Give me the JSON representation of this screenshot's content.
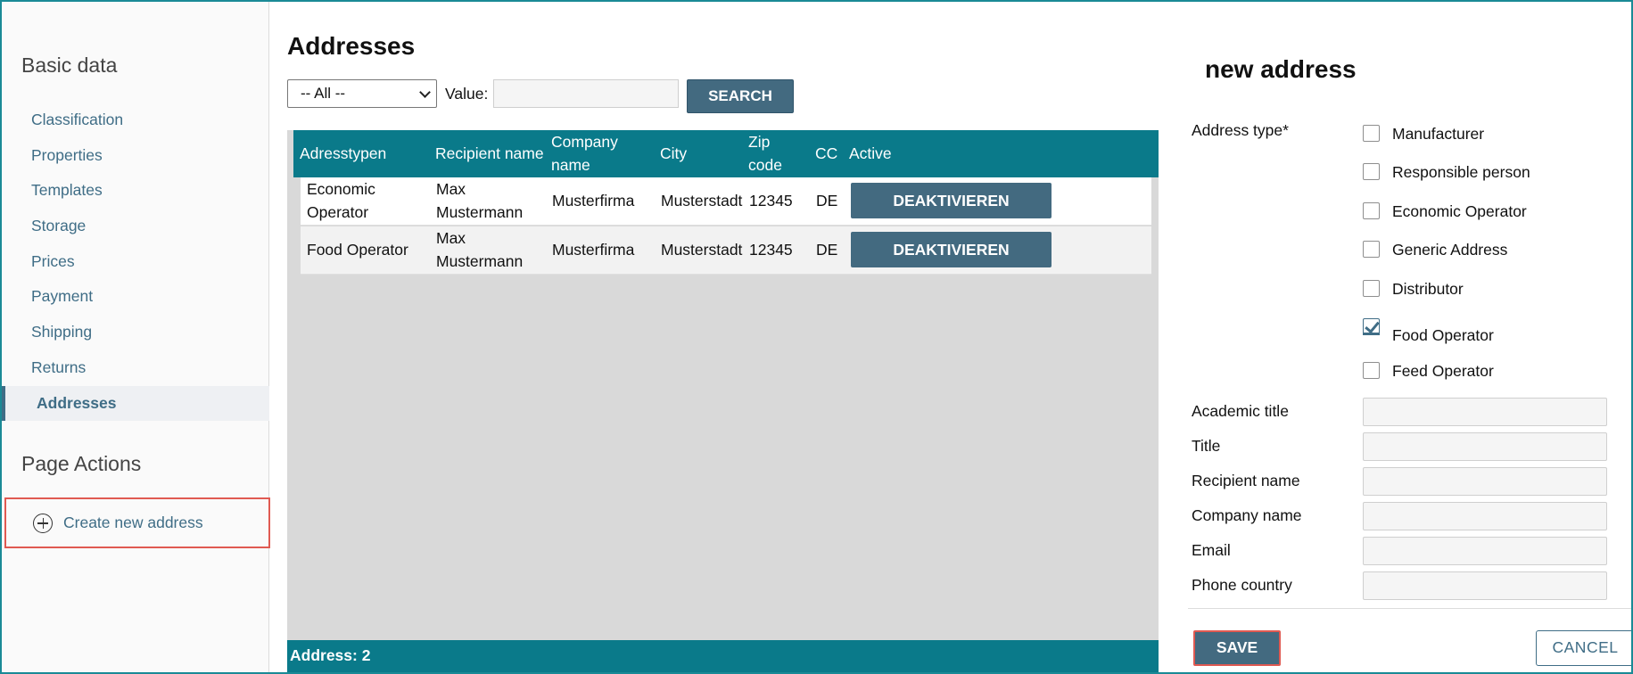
{
  "sidebar": {
    "basic_heading": "Basic data",
    "items": [
      {
        "label": "Classification"
      },
      {
        "label": "Properties"
      },
      {
        "label": "Templates"
      },
      {
        "label": "Storage"
      },
      {
        "label": "Prices"
      },
      {
        "label": "Payment"
      },
      {
        "label": "Shipping"
      },
      {
        "label": "Returns"
      },
      {
        "label": "Addresses",
        "active": true
      }
    ],
    "page_actions_heading": "Page Actions",
    "create_label": "Create new address"
  },
  "main": {
    "title": "Addresses",
    "filter": {
      "selected": "-- All --",
      "value_label": "Value:",
      "value": "",
      "search_label": "SEARCH"
    },
    "table": {
      "columns": [
        "Adresstypen",
        "Recipient name",
        "Company name",
        "City",
        "Zip code",
        "CC",
        "Active"
      ],
      "rows": [
        {
          "type": "Economic Operator",
          "recipient": "Max Mustermann",
          "company": "Musterfirma",
          "city": "Musterstadt",
          "zip": "12345",
          "cc": "DE",
          "action": "DEAKTIVIEREN"
        },
        {
          "type": "Food Operator",
          "recipient": "Max Mustermann",
          "company": "Musterfirma",
          "city": "Musterstadt",
          "zip": "12345",
          "cc": "DE",
          "action": "DEAKTIVIEREN"
        }
      ]
    },
    "footer": "Address: 2"
  },
  "form": {
    "title": "new address",
    "address_type_label": "Address type*",
    "types": [
      {
        "label": "Manufacturer",
        "checked": false
      },
      {
        "label": "Responsible person",
        "checked": false
      },
      {
        "label": "Economic Operator",
        "checked": false
      },
      {
        "label": "Generic Address",
        "checked": false
      },
      {
        "label": "Distributor",
        "checked": false
      },
      {
        "label": "Food Operator",
        "checked": true
      },
      {
        "label": "Feed Operator",
        "checked": false
      }
    ],
    "fields": [
      {
        "label": "Academic title",
        "value": ""
      },
      {
        "label": "Title",
        "value": ""
      },
      {
        "label": "Recipient name",
        "value": ""
      },
      {
        "label": "Company name",
        "value": ""
      },
      {
        "label": "Email",
        "value": ""
      },
      {
        "label": "Phone country",
        "value": ""
      }
    ],
    "save_label": "SAVE",
    "cancel_label": "CANCEL"
  }
}
